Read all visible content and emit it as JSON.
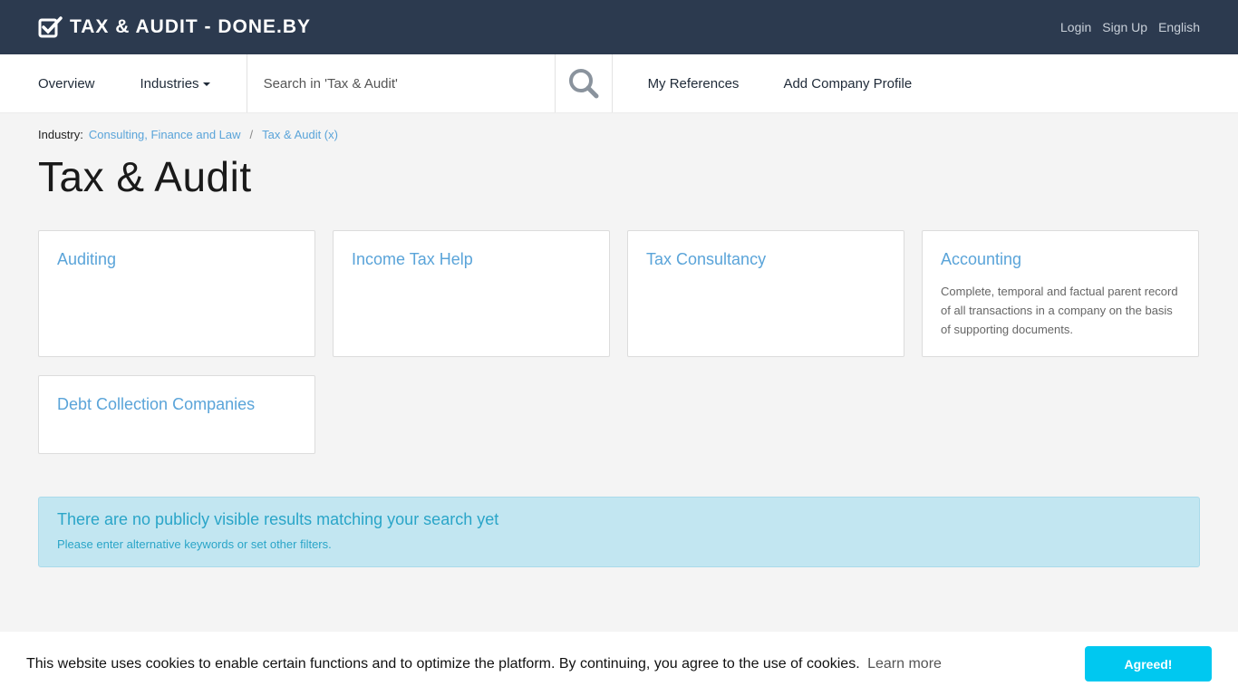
{
  "header": {
    "brand": "TAX & AUDIT - DONE.BY",
    "links": [
      "Login",
      "Sign Up",
      "English"
    ]
  },
  "nav": {
    "overview": "Overview",
    "industries": "Industries",
    "search_placeholder": "Search in 'Tax & Audit'",
    "my_references": "My References",
    "add_company_profile": "Add Company Profile"
  },
  "breadcrumb": {
    "prefix": "Industry:",
    "parent": "Consulting, Finance and Law",
    "current": "Tax & Audit (x)"
  },
  "page_title": "Tax & Audit",
  "cards": [
    {
      "title": "Auditing",
      "desc": ""
    },
    {
      "title": "Income Tax Help",
      "desc": ""
    },
    {
      "title": "Tax Consultancy",
      "desc": ""
    },
    {
      "title": "Accounting",
      "desc": "Complete, temporal and factual parent record of all transactions in a company on the basis of supporting documents."
    },
    {
      "title": "Debt Collection Companies",
      "desc": ""
    }
  ],
  "alert": {
    "title": "There are no publicly visible results matching your search yet",
    "text": "Please enter alternative keywords or set other filters."
  },
  "cookie": {
    "text": "This website uses cookies to enable certain functions and to optimize the platform. By continuing, you agree to the use of cookies.",
    "learn_more": "Learn more",
    "button": "Agreed!"
  },
  "colors": {
    "header_bg": "#2c3a4f",
    "link": "#5aa4d9",
    "alert_bg": "#c2e6f1",
    "cookie_button": "#00c8f0"
  }
}
